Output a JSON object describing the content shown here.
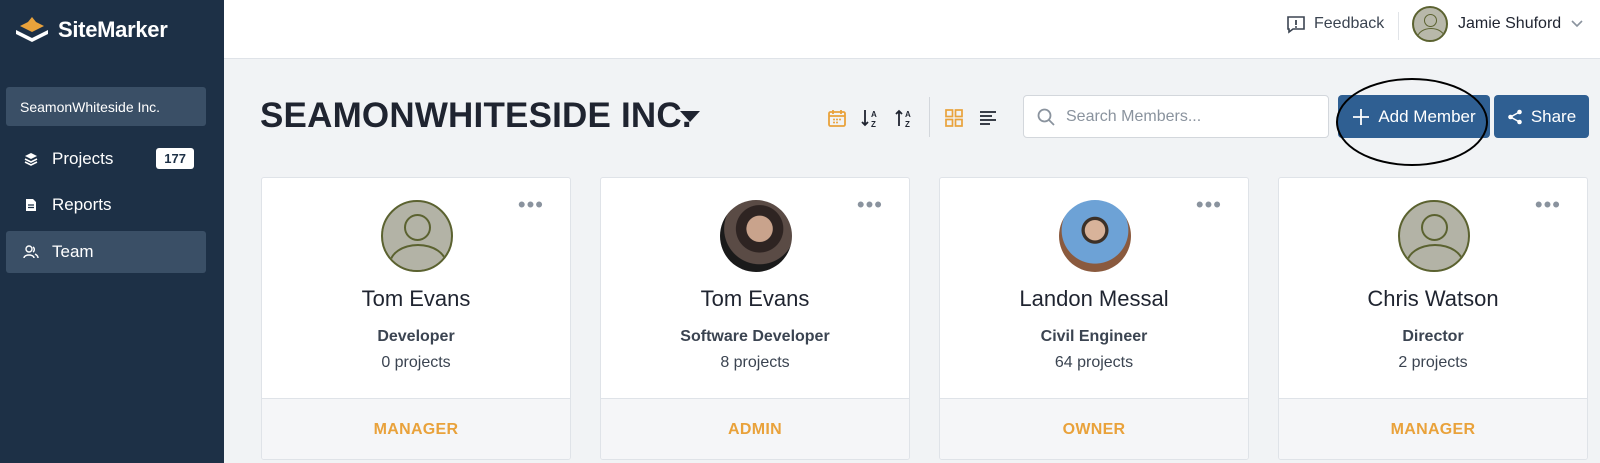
{
  "app": {
    "name": "SiteMarker"
  },
  "sidebar": {
    "org": "SeamonWhiteside Inc.",
    "items": [
      {
        "label": "Projects",
        "icon": "layers-icon",
        "badge": "177"
      },
      {
        "label": "Reports",
        "icon": "document-icon"
      },
      {
        "label": "Team",
        "icon": "team-icon",
        "active": true
      }
    ]
  },
  "topbar": {
    "feedback": "Feedback",
    "user_name": "Jamie Shuford"
  },
  "header": {
    "title": "SEAMONWHITESIDE INC.",
    "search_placeholder": "Search Members...",
    "add_member": "Add Member",
    "share": "Share",
    "tools": [
      "calendar-icon",
      "sort-ascending-icon",
      "sort-descending-icon",
      "grid-view-icon",
      "list-view-icon"
    ],
    "accent_color": "#e9a23b",
    "button_color": "#2f5f92"
  },
  "members": [
    {
      "name": "Tom Evans",
      "role": "Developer",
      "projects": "0 projects",
      "permission": "MANAGER",
      "avatar": "default"
    },
    {
      "name": "Tom Evans",
      "role": "Software Developer",
      "projects": "8 projects",
      "permission": "ADMIN",
      "avatar": "photo"
    },
    {
      "name": "Landon Messal",
      "role": "Civil Engineer",
      "projects": "64 projects",
      "permission": "OWNER",
      "avatar": "photo"
    },
    {
      "name": "Chris Watson",
      "role": "Director",
      "projects": "2 projects",
      "permission": "MANAGER",
      "avatar": "default"
    }
  ]
}
